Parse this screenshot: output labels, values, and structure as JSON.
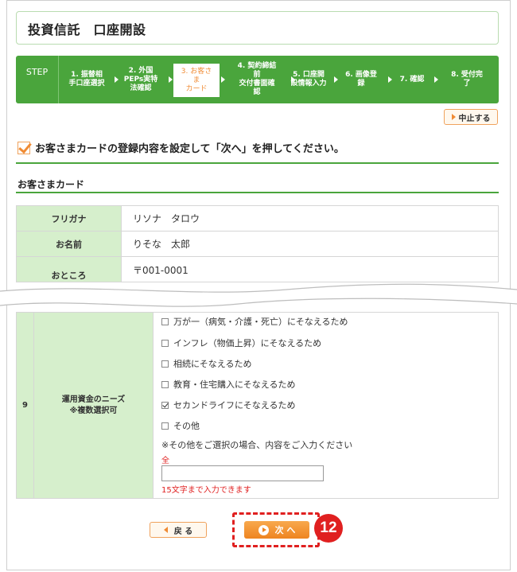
{
  "title": "投資信託　口座開設",
  "steps": {
    "label": "STEP",
    "items": [
      {
        "text": "1. 振替相\n手口座選択"
      },
      {
        "text": "2. 外国\nPEPs実特\n法確認"
      },
      {
        "text": "3. お客さ\nま\nカード"
      },
      {
        "text": "4. 契約締結\n前\n交付書面確\n認"
      },
      {
        "text": "5. 口座開\n設情報入力"
      },
      {
        "text": "6. 画像登\n録"
      },
      {
        "text": "7. 確認"
      },
      {
        "text": "8. 受付完\n了"
      }
    ],
    "active_index": 2
  },
  "cancel_label": "中止する",
  "instruction": "お客さまカードの登録内容を設定して「次へ」を押してください。",
  "section_title": "お客さまカード",
  "fields": {
    "furigana_label": "フリガナ",
    "furigana_value": "リソナ　タロウ",
    "name_label": "お名前",
    "name_value": "りそな　太郎",
    "address_label": "おところ",
    "address_value": "〒001-0001"
  },
  "needs": {
    "number": "9",
    "label_line1": "運用資金のニーズ",
    "label_line2": "※複数選択可",
    "options": [
      {
        "label": "万が一（病気・介護・死亡）にそなえるため",
        "checked": false
      },
      {
        "label": "インフレ（物価上昇）にそなえるため",
        "checked": false
      },
      {
        "label": "相続にそなえるため",
        "checked": false
      },
      {
        "label": "教育・住宅購入にそなえるため",
        "checked": false
      },
      {
        "label": "セカンドライフにそなえるため",
        "checked": true
      },
      {
        "label": "その他",
        "checked": false
      }
    ],
    "other_note": "※その他をご選択の場合、内容をご入力ください",
    "zenkaku": "全角",
    "other_value": "",
    "limit_note": "15文字まで入力できます"
  },
  "buttons": {
    "back": "戻 る",
    "next": "次 へ"
  },
  "badge": "12",
  "colors": {
    "green": "#4aa53c",
    "light_green": "#d6efcc",
    "orange": "#ee8420",
    "red": "#e02020"
  }
}
